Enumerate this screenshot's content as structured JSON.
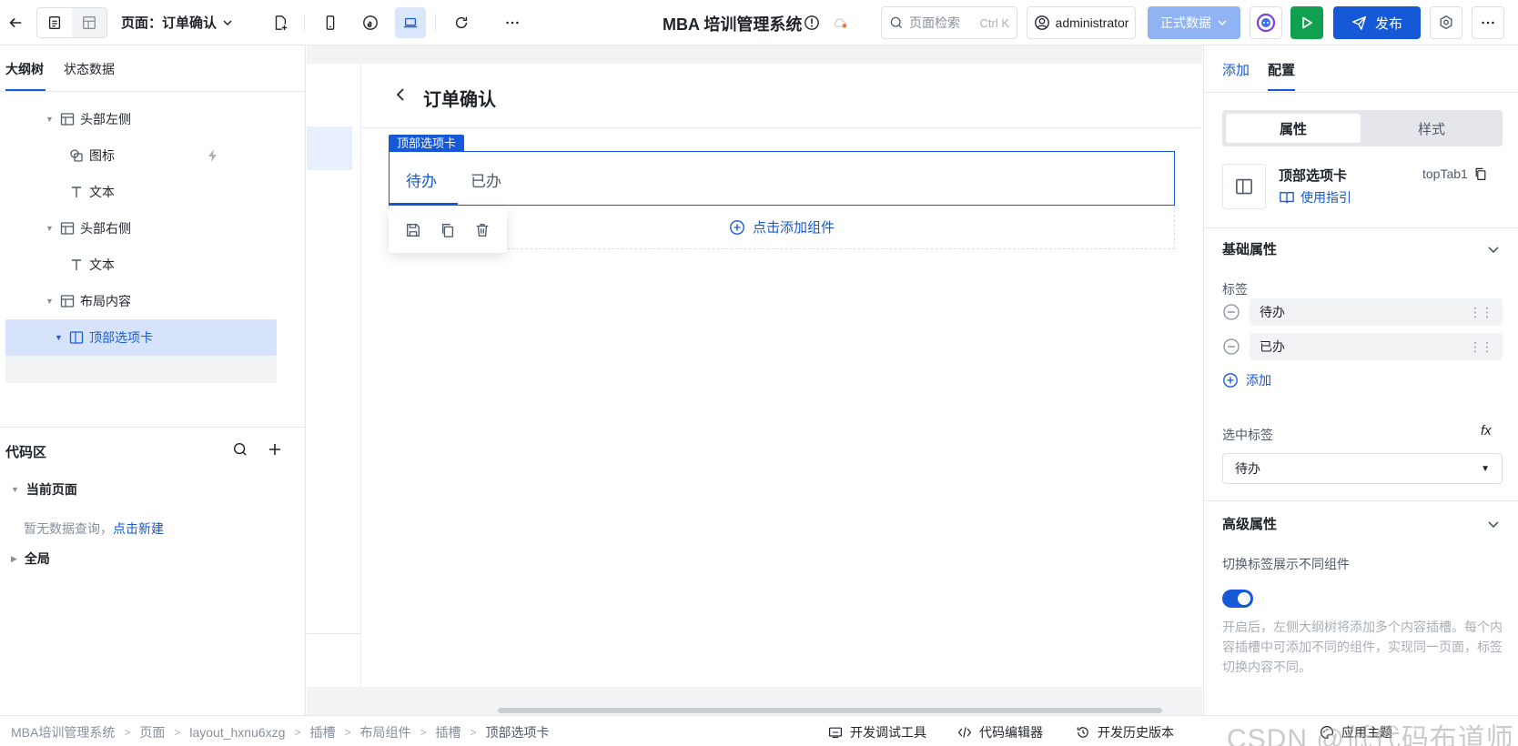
{
  "toolbar": {
    "page_label": "页面：订单确认",
    "app_title": "MBA 培训管理系统",
    "search_placeholder": "页面检索",
    "search_shortcut": "Ctrl K",
    "user": "administrator",
    "data_mode": "正式数据",
    "publish": "发布"
  },
  "left": {
    "tabs": [
      "大纲树",
      "状态数据"
    ],
    "tree": [
      {
        "label": "头部左侧"
      },
      {
        "label": "图标"
      },
      {
        "label": "文本"
      },
      {
        "label": "头部右侧"
      },
      {
        "label": "文本"
      },
      {
        "label": "布局内容"
      },
      {
        "label": "顶部选项卡"
      }
    ],
    "code": {
      "title": "代码区",
      "current_page": "当前页面",
      "empty_text": "暂无数据查询，",
      "empty_link": "点击新建",
      "global": "全局"
    }
  },
  "canvas": {
    "page_title": "订单确认",
    "component_label": "顶部选项卡",
    "tabs": [
      "待办",
      "已办"
    ],
    "add_component": "点击添加组件"
  },
  "right": {
    "tabs": [
      "添加",
      "配置"
    ],
    "segments": [
      "属性",
      "样式"
    ],
    "component_name": "顶部选项卡",
    "component_id": "topTab1",
    "guide": "使用指引",
    "basic_title": "基础属性",
    "tags_label": "标签",
    "options": [
      "待办",
      "已办"
    ],
    "add_label": "添加",
    "selected_label": "选中标签",
    "fx": "fx",
    "selected_value": "待办",
    "advanced_title": "高级属性",
    "switch_label": "切换标签展示不同组件",
    "switch_on": true,
    "help": "开启后，左侧大纲树将添加多个内容插槽。每个内容插槽中可添加不同的组件，实现同一页面，标签切换内容不同。"
  },
  "statusbar": {
    "breadcrumbs": [
      "MBA培训管理系统",
      "页面",
      "layout_hxnu6xzg",
      "插槽",
      "布局组件",
      "插槽",
      "顶部选项卡"
    ],
    "tools": [
      "开发调试工具",
      "代码编辑器",
      "开发历史版本",
      "应用主题"
    ],
    "watermark": "CSDN @低代码布道师"
  },
  "colors": {
    "primary": "#1559d9",
    "run": "#10a050",
    "data_mode_bg": "#8fb3f3",
    "selected_bg": "#d6e3fb"
  }
}
